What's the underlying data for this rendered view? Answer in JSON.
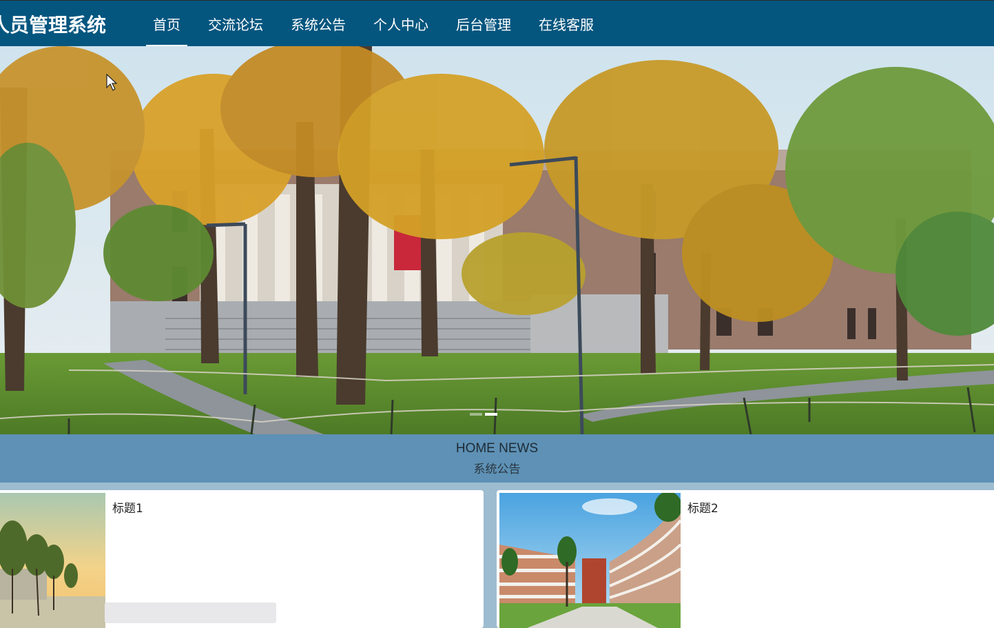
{
  "header": {
    "brand": "人员管理系统",
    "nav": [
      {
        "label": "首页",
        "active": true
      },
      {
        "label": "交流论坛",
        "active": false
      },
      {
        "label": "系统公告",
        "active": false
      },
      {
        "label": "个人中心",
        "active": false
      },
      {
        "label": "后台管理",
        "active": false
      },
      {
        "label": "在线客服",
        "active": false
      }
    ],
    "bar_color": "#04567f"
  },
  "carousel": {
    "slide_count": 2,
    "active_index": 1
  },
  "news_section": {
    "title_en": "HOME NEWS",
    "title_cn": "系统公告",
    "bg_color": "#5e91b5"
  },
  "news": [
    {
      "title": "标题1"
    },
    {
      "title": "标题2"
    }
  ]
}
